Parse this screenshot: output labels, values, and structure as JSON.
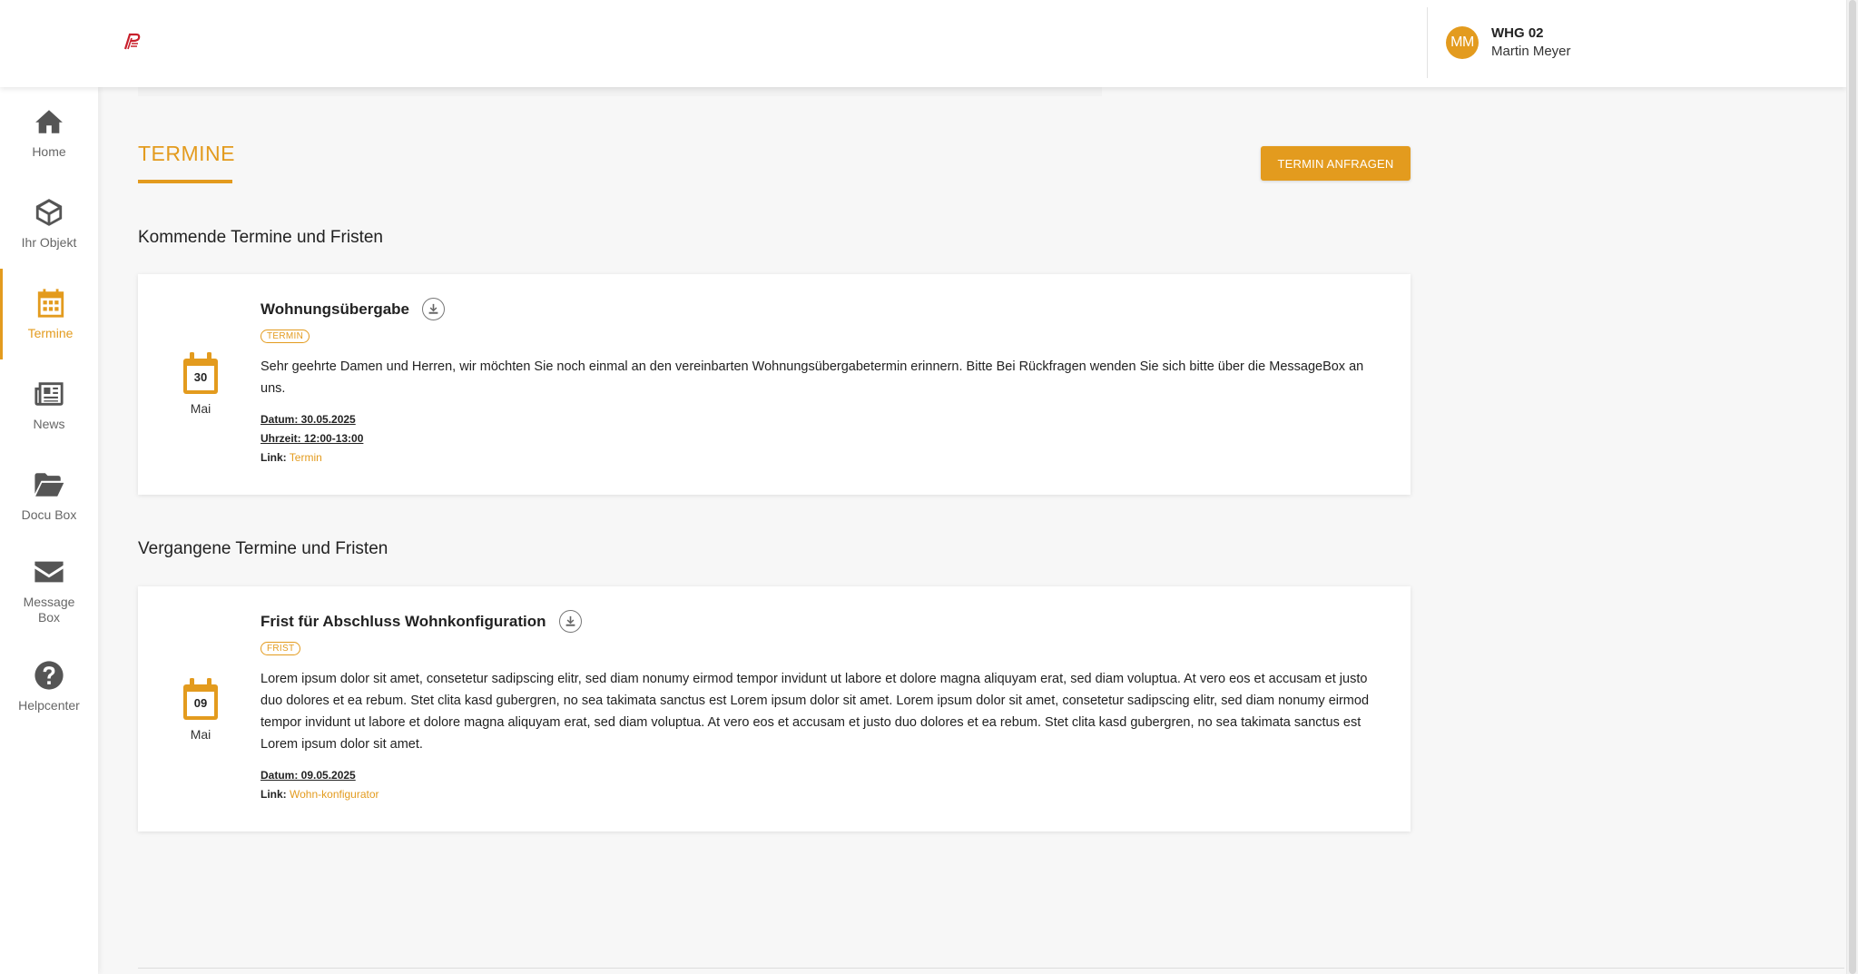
{
  "header": {
    "logo_icon": "brand-logo-icon",
    "user": {
      "initials": "MM",
      "unit": "WHG 02",
      "name": "Martin Meyer",
      "avatar_color": "#e39b1e"
    }
  },
  "sidebar": {
    "items": [
      {
        "label": "Home",
        "icon": "home-icon"
      },
      {
        "label": "Ihr Objekt",
        "icon": "cube-icon"
      },
      {
        "label": "Termine",
        "icon": "calendar-icon",
        "active": true
      },
      {
        "label": "News",
        "icon": "newspaper-icon"
      },
      {
        "label": "Docu Box",
        "icon": "folder-open-icon"
      },
      {
        "label": "Message Box",
        "icon": "envelope-icon"
      },
      {
        "label": "Helpcenter",
        "icon": "question-circle-icon"
      }
    ]
  },
  "page": {
    "title": "TERMINE",
    "request_button": "TERMIN ANFRAGEN",
    "accent_color": "#e39b1e"
  },
  "upcoming": {
    "heading": "Kommende Termine und Fristen",
    "items": [
      {
        "day": "30",
        "month": "Mai",
        "title": "Wohnungsübergabe",
        "badge": "TERMIN",
        "description": "Sehr geehrte Damen und Herren, wir möchten Sie noch einmal an den vereinbarten Wohnungsübergabetermin erinnern. Bitte Bei Rückfragen wenden Sie sich bitte über die MessageBox an uns.",
        "date_line": "Datum: 30.05.2025",
        "time_line": "Uhrzeit: 12:00-13:00",
        "link_label": "Link:",
        "link_text": "Termin"
      }
    ]
  },
  "past": {
    "heading": "Vergangene Termine und Fristen",
    "items": [
      {
        "day": "09",
        "month": "Mai",
        "title": "Frist für Abschluss Wohnkonfiguration",
        "badge": "FRIST",
        "description": "Lorem ipsum dolor sit amet, consetetur sadipscing elitr, sed diam nonumy eirmod tempor invidunt ut labore et dolore magna aliquyam erat, sed diam voluptua. At vero eos et accusam et justo duo dolores et ea rebum. Stet clita kasd gubergren, no sea takimata sanctus est Lorem ipsum dolor sit amet. Lorem ipsum dolor sit amet, consetetur sadipscing elitr, sed diam nonumy eirmod tempor invidunt ut labore et dolore magna aliquyam erat, sed diam voluptua. At vero eos et accusam et justo duo dolores et ea rebum. Stet clita kasd gubergren, no sea takimata sanctus est Lorem ipsum dolor sit amet.",
        "date_line": "Datum: 09.05.2025",
        "link_label": "Link:",
        "link_text": "Wohn-konfigurator"
      }
    ]
  }
}
